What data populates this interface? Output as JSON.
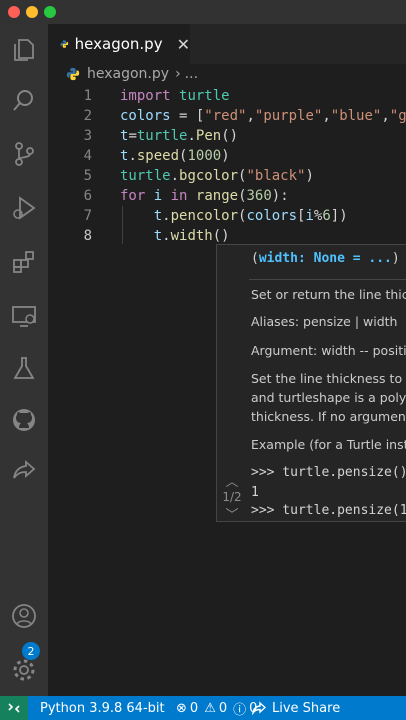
{
  "tab": {
    "filename": "hexagon.py",
    "close_glyph": "✕"
  },
  "breadcrumb": {
    "file": "hexagon.py",
    "separator": "›",
    "more": "..."
  },
  "editor": {
    "line_numbers": [
      "1",
      "2",
      "3",
      "4",
      "5",
      "6",
      "7",
      "8"
    ],
    "active_line": "8",
    "lines": [
      "import turtle",
      "colors = [\"red\",\"purple\",\"blue\",\"gre",
      "t=turtle.Pen()",
      "t.speed(1000)",
      "turtle.bgcolor(\"black\")",
      "for i in range(360):",
      "    t.pencolor(colors[i%6])",
      "    t.width()"
    ]
  },
  "hover": {
    "signature": "(width: None = ...)",
    "doc": [
      "Set or return the line thick",
      "Aliases: pensize | width",
      "Argument: width -- positiv",
      "Set the line thickness to w",
      "and turtleshape is a polyg",
      "thickness. If no argument",
      "Example (for a Turtle insta"
    ],
    "examples": [
      ">>> turtle.pensize()",
      "1",
      ">>> turtle.pensize(1"
    ],
    "pager": "1/2"
  },
  "activity": {
    "accounts_badge": "2"
  },
  "status": {
    "python": "Python 3.9.8 64-bit",
    "errors": "0",
    "warnings": "0",
    "info": "0",
    "live_share": "Live Share"
  },
  "colors": {
    "accent": "#007acc",
    "remote": "#16825d",
    "keyword": "#c586c0",
    "string": "#ce9178",
    "function": "#dcdcaa"
  }
}
